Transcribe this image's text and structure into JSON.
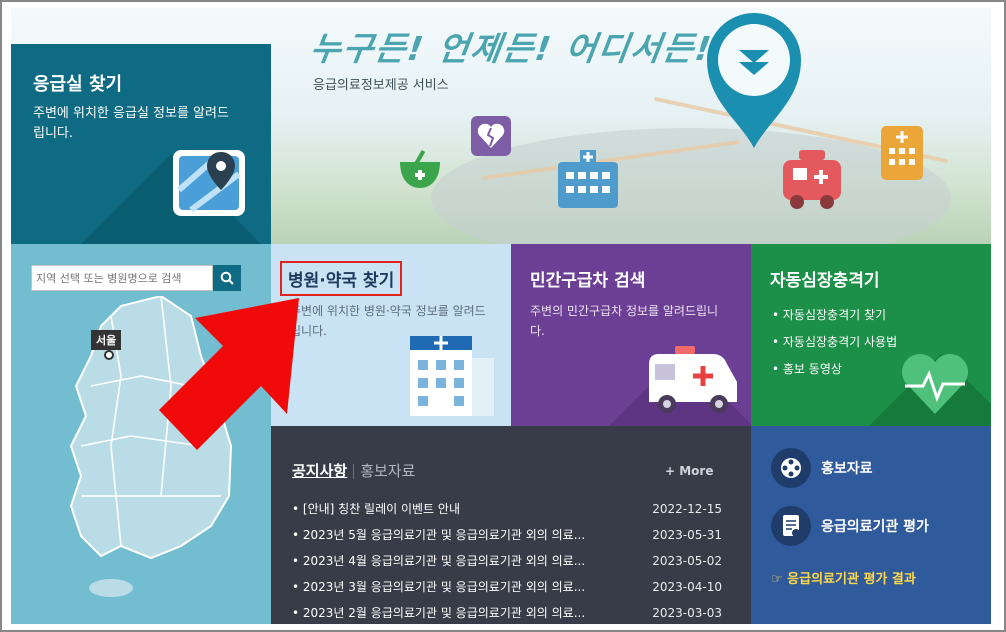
{
  "hero": {
    "slogan": "누구든! 언제든! 어디서든!",
    "subtitle": "응급의료정보제공 서비스"
  },
  "er_search": {
    "title": "응급실 찾기",
    "description": "주변에 위치한 응급실 정보를 알려드립니다."
  },
  "map_search": {
    "placeholder": "지역 선택 또는 병원명으로 검색",
    "region_label": "서울"
  },
  "tiles": {
    "hospital": {
      "title": "병원·약국 찾기",
      "description": "주변에 위치한 병원·약국 정보를 알려드립니다."
    },
    "ambulance": {
      "title": "민간구급차 검색",
      "description": "주변의 민간구급차 정보를 알려드립니다."
    },
    "aed": {
      "title": "자동심장충격기",
      "items": [
        "• 자동심장충격기 찾기",
        "• 자동심장충격기 사용법",
        "• 홍보 동영상"
      ]
    }
  },
  "notice": {
    "tab_active": "공지사항",
    "tab_inactive": "홍보자료",
    "more_label": "+ More",
    "items": [
      {
        "title": "• [안내] 칭찬 릴레이 이벤트 안내",
        "date": "2022-12-15"
      },
      {
        "title": "• 2023년 5월 응급의료기관 및 응급의료기관 외의 의료...",
        "date": "2023-05-31"
      },
      {
        "title": "• 2023년 4월 응급의료기관 및 응급의료기관 외의 의료...",
        "date": "2023-05-02"
      },
      {
        "title": "• 2023년 3월 응급의료기관 및 응급의료기관 외의 의료...",
        "date": "2023-04-10"
      },
      {
        "title": "• 2023년 2월 응급의료기관 및 응급의료기관 외의 의료...",
        "date": "2023-03-03"
      }
    ]
  },
  "promo": {
    "promo_label": "홍보자료",
    "evaluation_label": "응급의료기관 평가",
    "result_link": "☞ 응급의료기관 평가 결과"
  },
  "colors": {
    "teal": "#0e6b83",
    "hospital_bg": "#c9e3f4",
    "ambulance_bg": "#6b3f94",
    "aed_bg": "#1c9048",
    "notice_bg": "#373c48",
    "promo_bg": "#2f5a9c",
    "highlight_red": "#e2231a"
  }
}
